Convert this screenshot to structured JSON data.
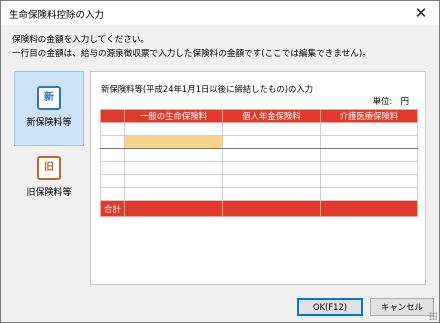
{
  "window": {
    "title": "生命保険料控除の入力",
    "close_label": "✕"
  },
  "instructions": [
    "保険料の金額を入力してください。",
    "一行目の金額は、給与の源泉徴収票で入力した保険料の金額です(ここでは編集できません)。"
  ],
  "tabs": [
    {
      "icon_char": "新",
      "label": "新保険料等",
      "selected": true
    },
    {
      "icon_char": "旧",
      "label": "旧保険料等",
      "selected": false
    }
  ],
  "panel": {
    "title": "新保険料等(平成24年1月1日以後に締結したもの)の入力",
    "unit": "単位:　円"
  },
  "table": {
    "columns": [
      "",
      "一般の生命保険料",
      "個人年金保険料",
      "介護医療保険料"
    ],
    "rows": [
      [
        "",
        "",
        "",
        ""
      ],
      [
        "",
        "",
        "",
        ""
      ],
      [
        "",
        "",
        "",
        ""
      ],
      [
        "",
        "",
        "",
        ""
      ],
      [
        "",
        "",
        "",
        ""
      ],
      [
        "",
        "",
        "",
        ""
      ]
    ],
    "total_label": "合計",
    "total_values": [
      "",
      "",
      ""
    ],
    "focused_cell": {
      "row": 1,
      "col": 1
    },
    "colors": {
      "header": "#de3a2e",
      "focus": "#fad38a"
    }
  },
  "buttons": {
    "ok": "OK(F12)",
    "cancel": "キャンセル"
  }
}
